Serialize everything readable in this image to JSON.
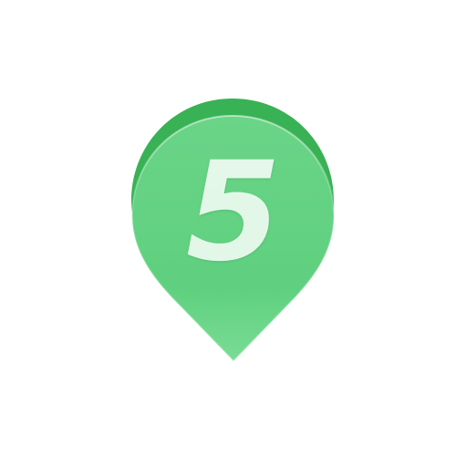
{
  "marker": {
    "number": "5",
    "icon": "map-pin-icon",
    "colors": {
      "back": "#37b255",
      "front_top": "#6fd58a",
      "front_bottom": "#5ccf7e",
      "digit": "#eefbf1"
    }
  }
}
